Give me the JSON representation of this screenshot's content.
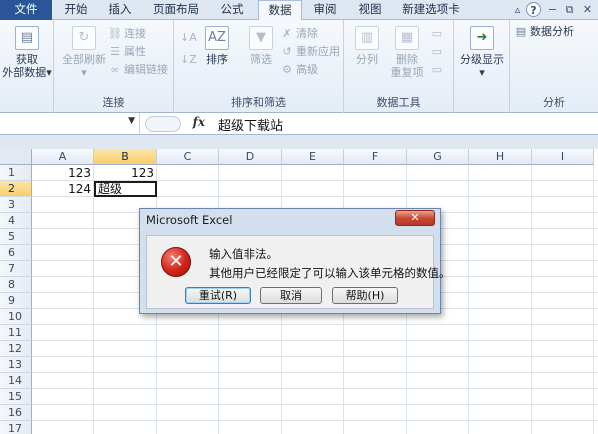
{
  "tabs": [
    {
      "label": "文件",
      "active": false,
      "file": true
    },
    {
      "label": "开始",
      "active": false
    },
    {
      "label": "插入",
      "active": false
    },
    {
      "label": "页面布局",
      "active": false
    },
    {
      "label": "公式",
      "active": false
    },
    {
      "label": "数据",
      "active": true
    },
    {
      "label": "审阅",
      "active": false
    },
    {
      "label": "视图",
      "active": false
    },
    {
      "label": "新建选项卡",
      "active": false
    }
  ],
  "window_controls": {
    "minimize": "▵",
    "help": "?",
    "restore": "−",
    "maximize": "⧉",
    "close": "✕"
  },
  "ribbon": {
    "get_external": {
      "line1": "获取",
      "line2": "外部数据",
      "arrow": "▾"
    },
    "connections": {
      "label": "连接",
      "refresh_all": "全部刷新",
      "connections": "连接",
      "properties": "属性",
      "edit_links": "编辑链接"
    },
    "sort_filter": {
      "label": "排序和筛选",
      "sort": "排序",
      "filter": "筛选",
      "clear": "清除",
      "reapply": "重新应用",
      "advanced": "高级"
    },
    "data_tools": {
      "label": "数据工具",
      "split": "分列",
      "remove_dup_1": "删除",
      "remove_dup_2": "重复项"
    },
    "outline": {
      "show_detail": "分级显示",
      "arrow": "▾"
    },
    "analysis": {
      "label": "分析",
      "data_analysis": "数据分析"
    }
  },
  "formula_bar": {
    "fx": "fx",
    "content": "超级下载站"
  },
  "grid": {
    "columns": [
      "A",
      "B",
      "C",
      "D",
      "E",
      "F",
      "G",
      "H",
      "I"
    ],
    "rows": [
      "1",
      "2",
      "3",
      "4",
      "5",
      "6",
      "7",
      "8",
      "9",
      "10",
      "11",
      "12",
      "13",
      "14",
      "15",
      "16",
      "17"
    ],
    "cells": {
      "A1": "123",
      "B1": "123",
      "A2": "124",
      "B2": "超级"
    }
  },
  "dialog": {
    "title": "Microsoft Excel",
    "close": "✕",
    "icon": "✕",
    "message1": "输入值非法。",
    "message2": "其他用户已经限定了可以输入该单元格的数值。",
    "retry": "重试(R)",
    "cancel": "取消",
    "help": "帮助(H)"
  }
}
